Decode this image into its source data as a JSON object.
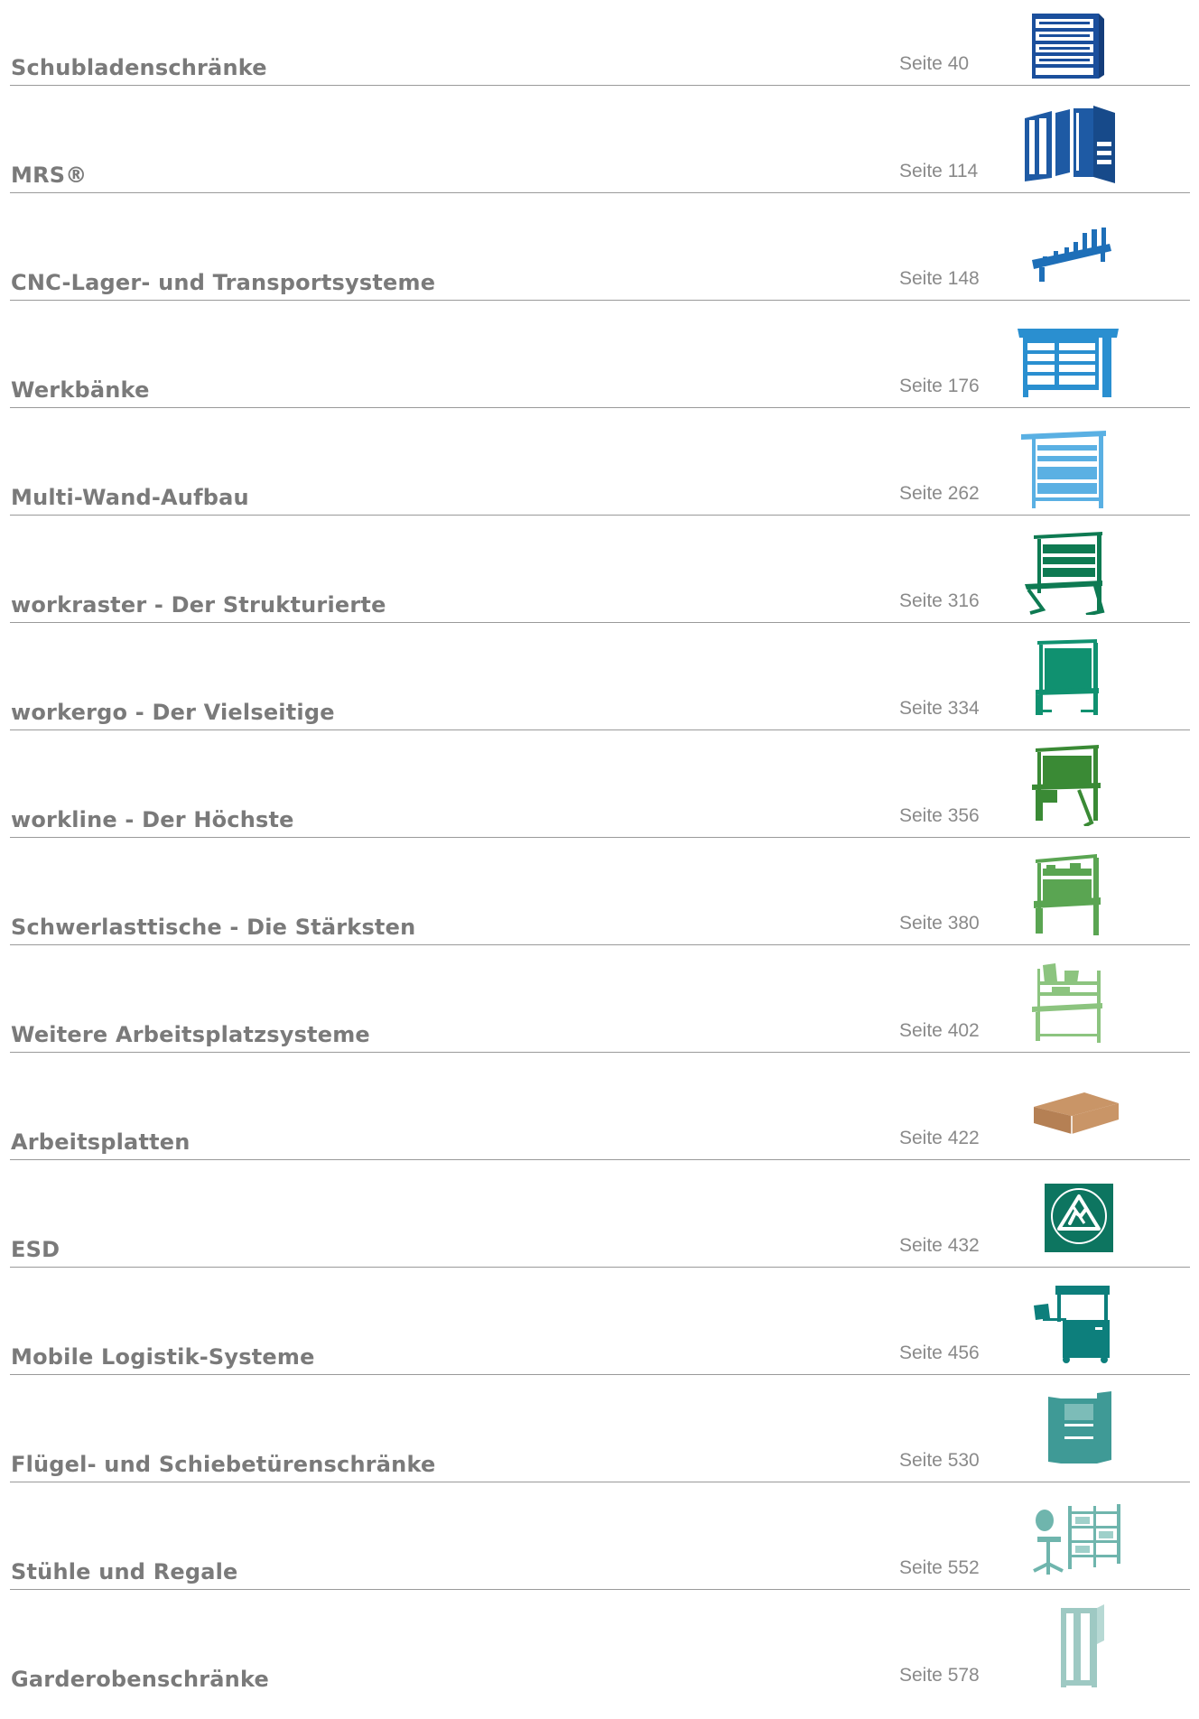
{
  "entries": [
    {
      "title": "Schubladenschränke",
      "page": "Seite 40",
      "icon": "drawer-cabinet-icon",
      "color": "#1b4f9c"
    },
    {
      "title": "MRS®",
      "page": "Seite 114",
      "icon": "modular-rack-system-icon",
      "color": "#1e5aa4"
    },
    {
      "title": "CNC-Lager- und Transportsysteme",
      "page": "Seite 148",
      "icon": "cnc-tool-holder-icon",
      "color": "#1e6fb8"
    },
    {
      "title": "Werkbänke",
      "page": "Seite 176",
      "icon": "workbench-icon",
      "color": "#2a8fd0"
    },
    {
      "title": "Multi-Wand-Aufbau",
      "page": "Seite 262",
      "icon": "multi-wall-icon",
      "color": "#5ab0e3"
    },
    {
      "title": "workraster - Der Strukturierte",
      "page": "Seite 316",
      "icon": "workstation-icon",
      "color": "#0e7a52"
    },
    {
      "title": "workergo - Der Vielseitige",
      "page": "Seite 334",
      "icon": "workstation-icon",
      "color": "#109170"
    },
    {
      "title": "workline - Der Höchste",
      "page": "Seite 356",
      "icon": "workstation-icon",
      "color": "#3a8a35"
    },
    {
      "title": "Schwerlasttische - Die Stärksten",
      "page": "Seite 380",
      "icon": "heavy-duty-table-icon",
      "color": "#5aa552"
    },
    {
      "title": "Weitere Arbeitsplatzsysteme",
      "page": "Seite 402",
      "icon": "workplace-system-icon",
      "color": "#8cc47f"
    },
    {
      "title": "Arbeitsplatten",
      "page": "Seite 422",
      "icon": "worktop-icon",
      "color": "#c99567"
    },
    {
      "title": "ESD",
      "page": "Seite 432",
      "icon": "esd-symbol-icon",
      "color": "#0d7560"
    },
    {
      "title": "Mobile Logistik-Systeme",
      "page": "Seite 456",
      "icon": "mobile-cart-icon",
      "color": "#0d7f7c"
    },
    {
      "title": "Flügel- und Schiebetürenschränke",
      "page": "Seite 530",
      "icon": "door-cabinet-icon",
      "color": "#3f9a96"
    },
    {
      "title": "Stühle und Regale",
      "page": "Seite 552",
      "icon": "chair-and-shelf-icon",
      "color": "#6fb5ad"
    },
    {
      "title": "Garderobenschränke",
      "page": "Seite 578",
      "icon": "locker-icon",
      "color": "#9ec9c3"
    }
  ]
}
